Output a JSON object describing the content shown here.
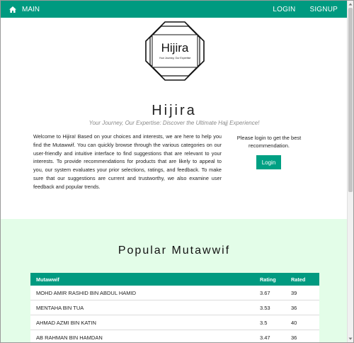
{
  "navbar": {
    "home_label": "MAIN",
    "login_label": "LOGIN",
    "signup_label": "SIGNUP",
    "bg_color": "#009a80"
  },
  "logo": {
    "text": "Hijira",
    "subtext": "Your Journey, Our Expertise"
  },
  "hero": {
    "title": "Hijira",
    "tagline": "Your Journey, Our Expertise: Discover the Ultimate Hajj Experience!",
    "intro": "Welcome to Hijira! Based on your choices and interests, we are here to help you find the Mutawwif. You can quickly browse through the various categories on our user-friendly and intuitive interface to find suggestions that are relevant to your interests. To provide recommendations for products that are likely to appeal to you, our system evaluates your prior selections, ratings, and feedback. To make sure that our suggestions are current and trustworthy, we also examine user feedback and popular trends.",
    "login_prompt": "Please login to get the best recommendation.",
    "login_button": "Login"
  },
  "popular": {
    "title": "Popular Mutawwif",
    "section_bg": "#e3fde8",
    "columns": [
      "Mutawwif",
      "Rating",
      "Rated"
    ],
    "rows": [
      {
        "name": "MOHD AMIR RASHID BIN ABDUL HAMID",
        "rating": "3.67",
        "rated": "39"
      },
      {
        "name": "MENTAHA BIN TUA",
        "rating": "3.53",
        "rated": "36"
      },
      {
        "name": "AHMAD AZMI BIN KATIN",
        "rating": "3.5",
        "rated": "40"
      },
      {
        "name": "AB RAHMAN BIN HAMDAN",
        "rating": "3.47",
        "rated": "36"
      }
    ]
  }
}
